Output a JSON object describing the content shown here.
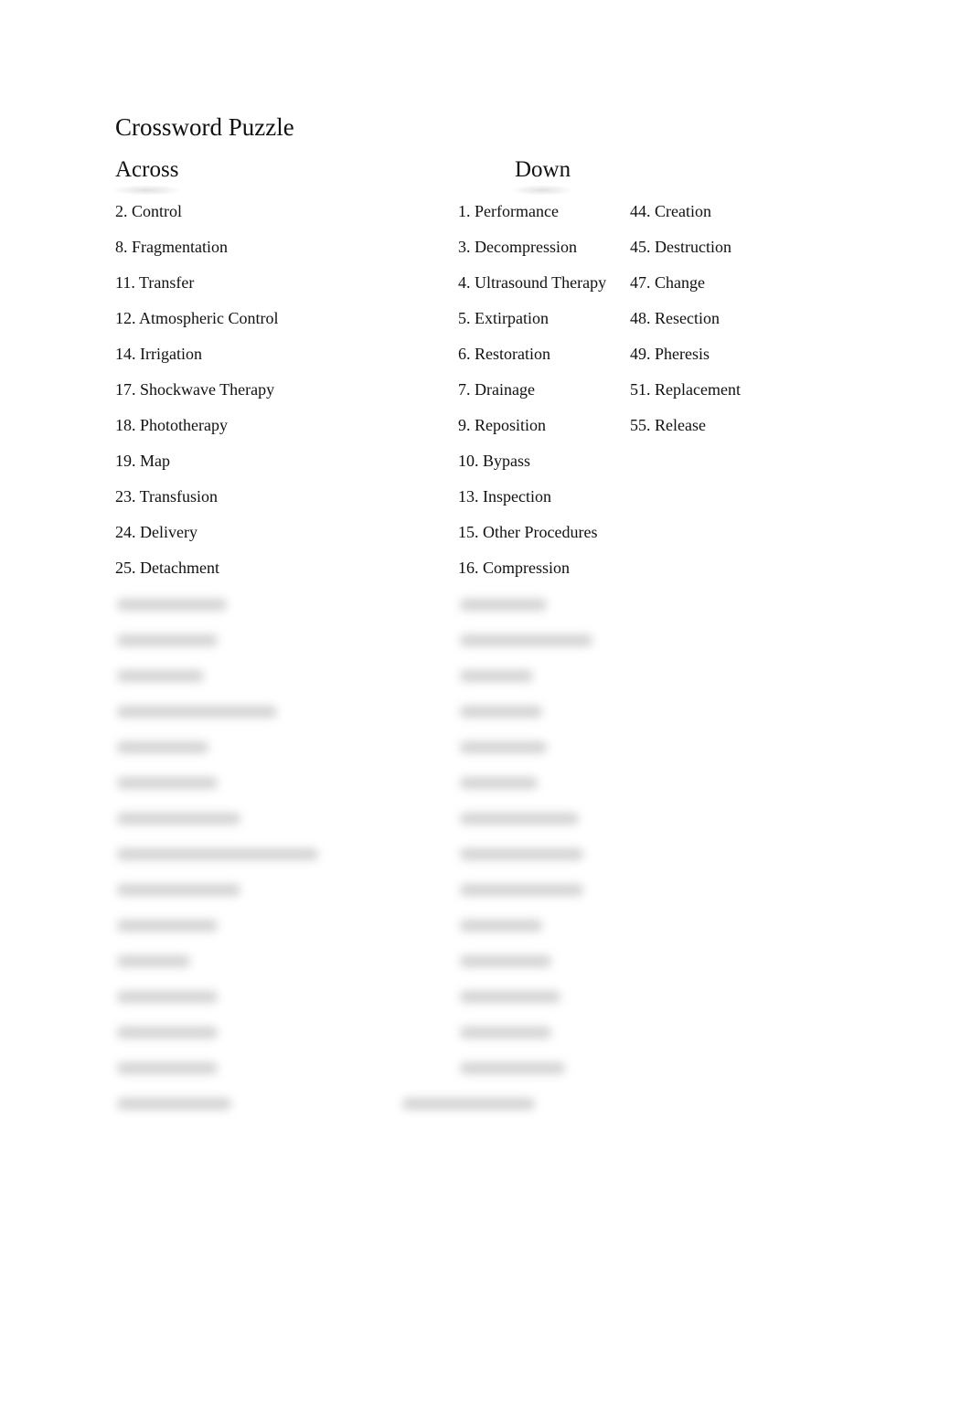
{
  "title": "Crossword Puzzle",
  "across": {
    "heading": "Across",
    "items": [
      "2. Control",
      "8. Fragmentation",
      "11. Transfer",
      "12. Atmospheric Control",
      "14. Irrigation",
      "17. Shockwave Therapy",
      "18. Phototherapy",
      "19. Map",
      "23. Transfusion",
      "24. Delivery",
      "25. Detachment"
    ]
  },
  "down": {
    "heading": "Down",
    "col1": [
      "1. Performance",
      "3. Decompression",
      "4. Ultrasound Therapy",
      "5. Extirpation",
      "6. Restoration",
      "7. Drainage",
      "9. Reposition",
      "10. Bypass",
      "13. Inspection",
      "15. Other Procedures",
      "16. Compression"
    ],
    "col2": [
      "44. Creation",
      "45. Destruction",
      "47. Change",
      "48. Resection",
      "49. Pheresis",
      "51. Replacement",
      "55. Release"
    ]
  }
}
